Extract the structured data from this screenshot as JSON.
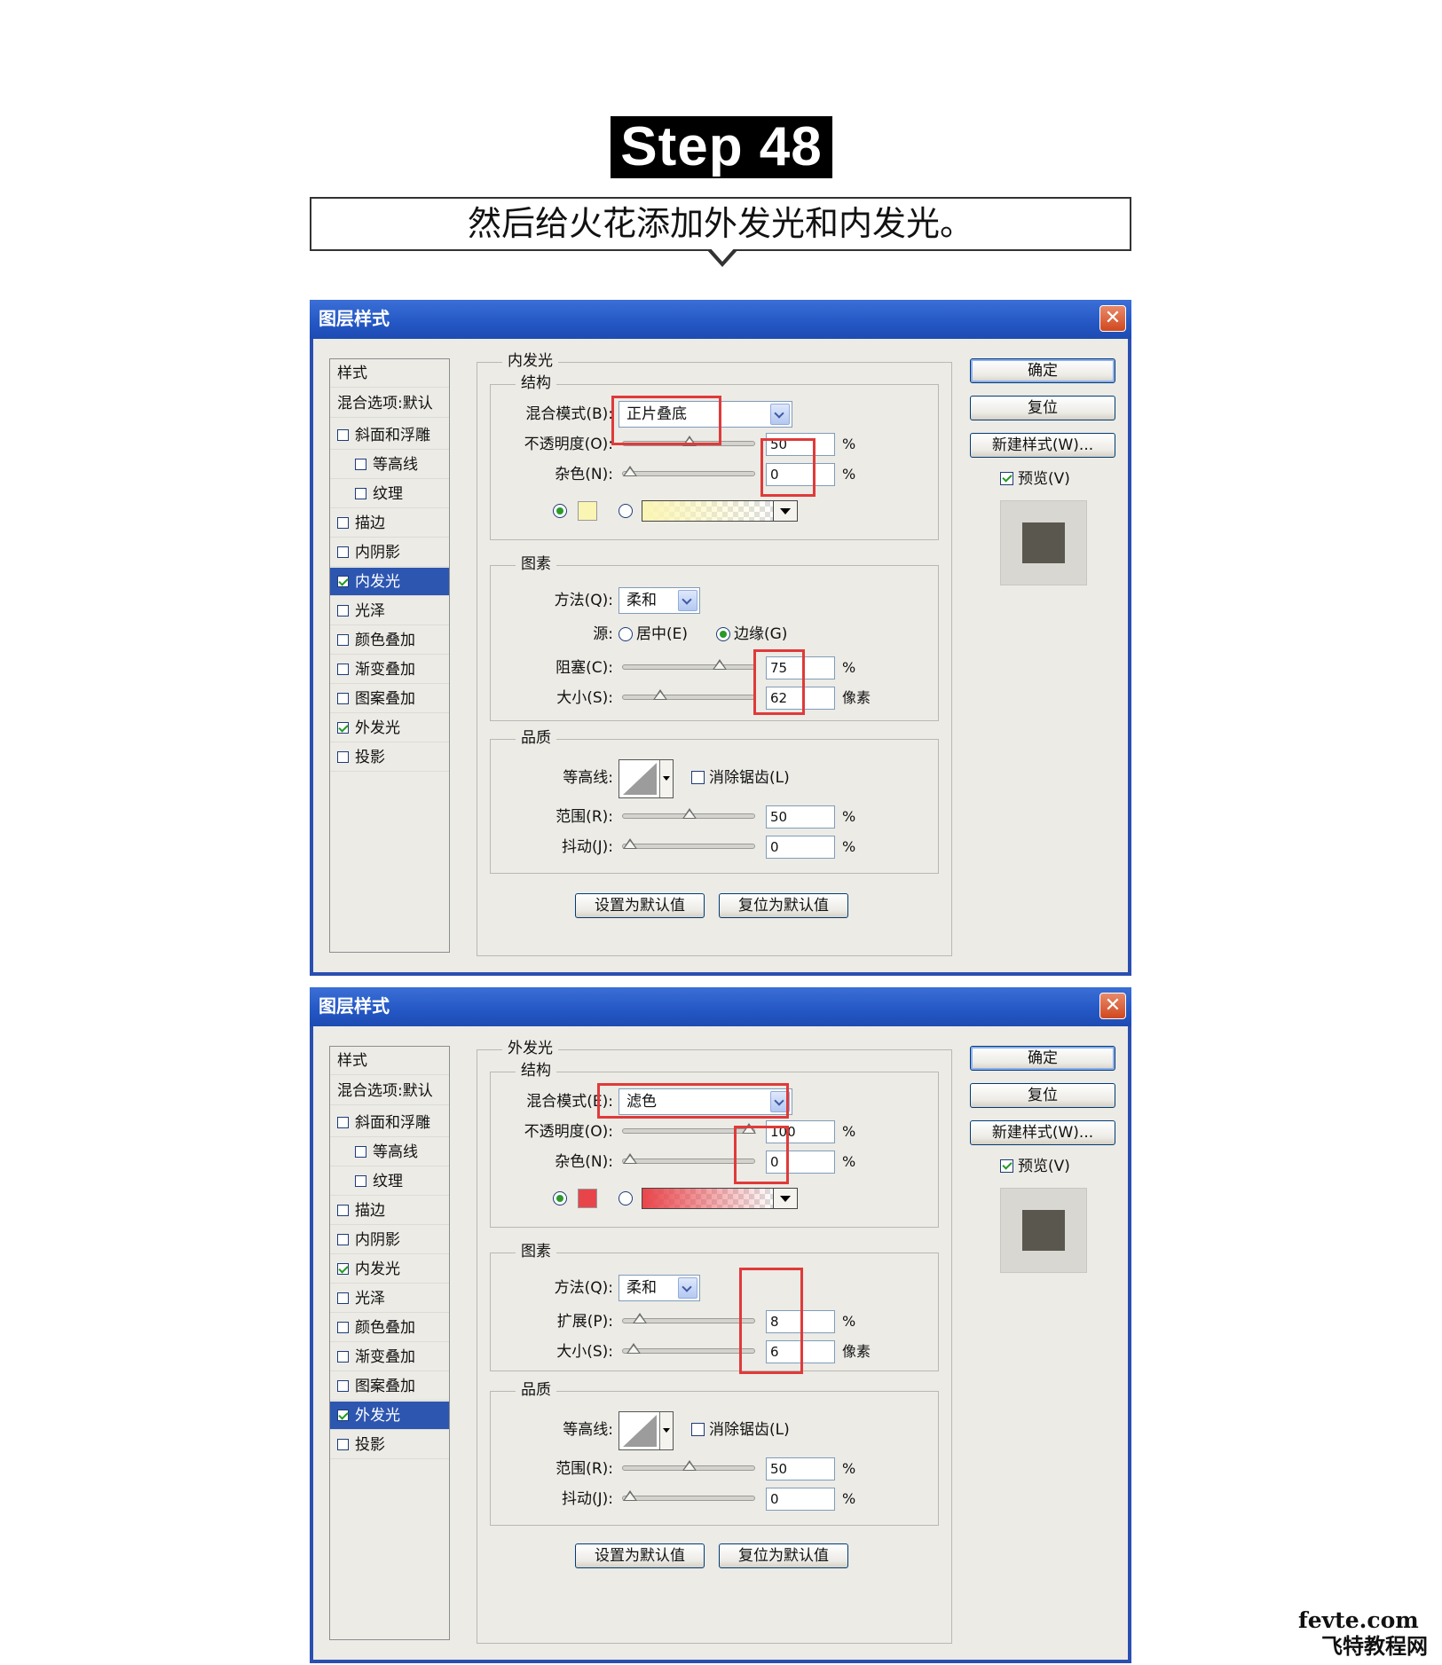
{
  "header": {
    "step": "Step 48",
    "caption": "然后给火花添加外发光和内发光。"
  },
  "colors": {
    "titlebar": "#2457c4",
    "highlight": "#e03a3a",
    "inner_glow_color": "#fbf5b4",
    "outer_glow_color": "#e8454b",
    "preview_square": "#5a574e"
  },
  "icons": {
    "close": "close-icon",
    "dropdown": "chevron-down-icon",
    "slider": "slider-thumb-icon"
  },
  "dialog1": {
    "title": "图层样式",
    "close": "✕",
    "styles_header": "样式",
    "blend_header": "混合选项:默认",
    "styles": [
      {
        "label": "斜面和浮雕",
        "checked": false,
        "indent": false,
        "selected": false
      },
      {
        "label": "等高线",
        "checked": false,
        "indent": true,
        "selected": false
      },
      {
        "label": "纹理",
        "checked": false,
        "indent": true,
        "selected": false
      },
      {
        "label": "描边",
        "checked": false,
        "indent": false,
        "selected": false
      },
      {
        "label": "内阴影",
        "checked": false,
        "indent": false,
        "selected": false
      },
      {
        "label": "内发光",
        "checked": true,
        "indent": false,
        "selected": true
      },
      {
        "label": "光泽",
        "checked": false,
        "indent": false,
        "selected": false
      },
      {
        "label": "颜色叠加",
        "checked": false,
        "indent": false,
        "selected": false
      },
      {
        "label": "渐变叠加",
        "checked": false,
        "indent": false,
        "selected": false
      },
      {
        "label": "图案叠加",
        "checked": false,
        "indent": false,
        "selected": false
      },
      {
        "label": "外发光",
        "checked": true,
        "indent": false,
        "selected": false
      },
      {
        "label": "投影",
        "checked": false,
        "indent": false,
        "selected": false
      }
    ],
    "panel_title": "内发光",
    "structure": {
      "legend": "结构",
      "blend_label": "混合模式(B):",
      "blend_value": "正片叠底",
      "opacity_label": "不透明度(O):",
      "opacity_value": "50",
      "opacity_pct": 50,
      "noise_label": "杂色(N):",
      "noise_value": "0",
      "noise_pct": 0,
      "pct": "%"
    },
    "elements": {
      "legend": "图素",
      "method_label": "方法(Q):",
      "method_value": "柔和",
      "source_label": "源:",
      "source_center": "居中(E)",
      "source_edge": "边缘(G)",
      "choke_label": "阻塞(C):",
      "choke_value": "75",
      "choke_pct": 75,
      "size_label": "大小(S):",
      "size_value": "62",
      "size_pct": 25,
      "pct": "%",
      "px": "像素"
    },
    "quality": {
      "legend": "品质",
      "contour_label": "等高线:",
      "antialias_label": "消除锯齿(L)",
      "range_label": "范围(R):",
      "range_value": "50",
      "range_pct": 50,
      "jitter_label": "抖动(J):",
      "jitter_value": "0",
      "jitter_pct": 0,
      "pct": "%"
    },
    "make_default": "设置为默认值",
    "reset_default": "复位为默认值",
    "ok": "确定",
    "reset": "复位",
    "new_style": "新建样式(W)...",
    "preview": "预览(V)"
  },
  "dialog2": {
    "title": "图层样式",
    "close": "✕",
    "styles_header": "样式",
    "blend_header": "混合选项:默认",
    "styles": [
      {
        "label": "斜面和浮雕",
        "checked": false,
        "indent": false,
        "selected": false
      },
      {
        "label": "等高线",
        "checked": false,
        "indent": true,
        "selected": false
      },
      {
        "label": "纹理",
        "checked": false,
        "indent": true,
        "selected": false
      },
      {
        "label": "描边",
        "checked": false,
        "indent": false,
        "selected": false
      },
      {
        "label": "内阴影",
        "checked": false,
        "indent": false,
        "selected": false
      },
      {
        "label": "内发光",
        "checked": true,
        "indent": false,
        "selected": false
      },
      {
        "label": "光泽",
        "checked": false,
        "indent": false,
        "selected": false
      },
      {
        "label": "颜色叠加",
        "checked": false,
        "indent": false,
        "selected": false
      },
      {
        "label": "渐变叠加",
        "checked": false,
        "indent": false,
        "selected": false
      },
      {
        "label": "图案叠加",
        "checked": false,
        "indent": false,
        "selected": false
      },
      {
        "label": "外发光",
        "checked": true,
        "indent": false,
        "selected": true
      },
      {
        "label": "投影",
        "checked": false,
        "indent": false,
        "selected": false
      }
    ],
    "panel_title": "外发光",
    "structure": {
      "legend": "结构",
      "blend_label": "混合模式(E):",
      "blend_value": "滤色",
      "opacity_label": "不透明度(O):",
      "opacity_value": "100",
      "opacity_pct": 100,
      "noise_label": "杂色(N):",
      "noise_value": "0",
      "noise_pct": 0,
      "pct": "%"
    },
    "elements": {
      "legend": "图素",
      "method_label": "方法(Q):",
      "method_value": "柔和",
      "spread_label": "扩展(P):",
      "spread_value": "8",
      "spread_pct": 8,
      "size_label": "大小(S):",
      "size_value": "6",
      "size_pct": 3,
      "pct": "%",
      "px": "像素"
    },
    "quality": {
      "legend": "品质",
      "contour_label": "等高线:",
      "antialias_label": "消除锯齿(L)",
      "range_label": "范围(R):",
      "range_value": "50",
      "range_pct": 50,
      "jitter_label": "抖动(J):",
      "jitter_value": "0",
      "jitter_pct": 0,
      "pct": "%"
    },
    "make_default": "设置为默认值",
    "reset_default": "复位为默认值",
    "ok": "确定",
    "reset": "复位",
    "new_style": "新建样式(W)...",
    "preview": "预览(V)"
  },
  "watermark": {
    "line1": "fevte.com",
    "line2": "飞特教程网"
  }
}
